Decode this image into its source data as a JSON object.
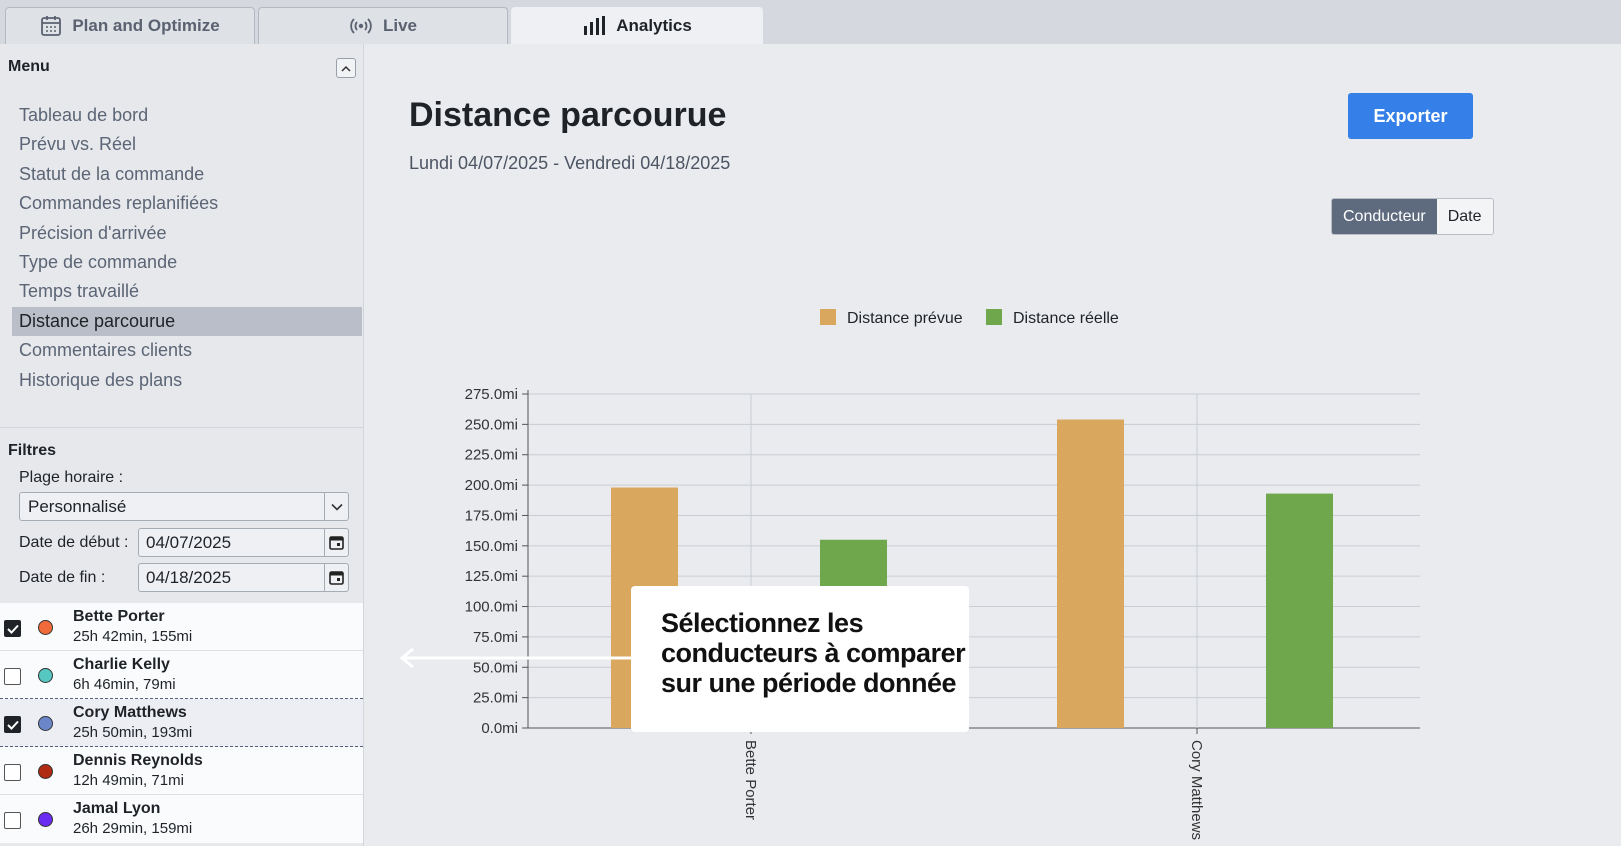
{
  "tabs": [
    {
      "label": "Plan and Optimize",
      "icon": "calendar-icon"
    },
    {
      "label": "Live",
      "icon": "broadcast-icon"
    },
    {
      "label": "Analytics",
      "icon": "bar-chart-icon",
      "active": true
    }
  ],
  "sidebar": {
    "menu_title": "Menu",
    "items": [
      {
        "label": "Tableau de bord"
      },
      {
        "label": "Prévu vs. Réel"
      },
      {
        "label": "Statut de la commande"
      },
      {
        "label": "Commandes replanifiées"
      },
      {
        "label": "Précision d'arrivée"
      },
      {
        "label": "Type de commande"
      },
      {
        "label": "Temps travaillé"
      },
      {
        "label": "Distance parcourue",
        "active": true
      },
      {
        "label": "Commentaires clients"
      },
      {
        "label": "Historique des plans"
      }
    ],
    "filters": {
      "title": "Filtres",
      "time_range_label": "Plage horaire :",
      "time_range_value": "Personnalisé",
      "start_label": "Date de début :",
      "start_value": "04/07/2025",
      "end_label": "Date de fin :",
      "end_value": "04/18/2025"
    },
    "drivers": [
      {
        "name": "Bette Porter",
        "stats": "25h 42min, 155mi",
        "checked": true,
        "color": "#f06a3a"
      },
      {
        "name": "Charlie Kelly",
        "stats": "6h 46min, 79mi",
        "checked": false,
        "color": "#57c7c2"
      },
      {
        "name": "Cory Matthews",
        "stats": "25h 50min, 193mi",
        "checked": true,
        "color": "#6b86c9"
      },
      {
        "name": "Dennis Reynolds",
        "stats": "12h 49min, 71mi",
        "checked": false,
        "color": "#b12a12"
      },
      {
        "name": "Jamal Lyon",
        "stats": "26h 29min, 159mi",
        "checked": false,
        "color": "#6a2cf0"
      }
    ]
  },
  "main": {
    "title": "Distance parcourue",
    "subtitle": "Lundi 04/07/2025 - Vendredi 04/18/2025",
    "export_label": "Exporter",
    "toggle": {
      "on": "Conducteur",
      "off": "Date"
    },
    "callout": {
      "line1": "Sélectionnez les",
      "line2": "conducteurs à comparer",
      "line3": "sur une période donnée"
    }
  },
  "colors": {
    "planned": "#d9a75e",
    "actual": "#6fa74d",
    "accent": "#3580e8"
  },
  "chart_data": {
    "type": "bar",
    "categories": [
      "Bette Porter",
      "Cory Matthews"
    ],
    "series": [
      {
        "name": "Distance prévue",
        "values": [
          198,
          254
        ]
      },
      {
        "name": "Distance réelle",
        "values": [
          155,
          193
        ]
      }
    ],
    "ylim": [
      0,
      275
    ],
    "yticks": [
      "0.0mi",
      "25.0mi",
      "50.0mi",
      "75.0mi",
      "100.0mi",
      "125.0mi",
      "150.0mi",
      "175.0mi",
      "200.0mi",
      "225.0mi",
      "250.0mi",
      "275.0mi"
    ],
    "legend": "top",
    "grid": true
  }
}
